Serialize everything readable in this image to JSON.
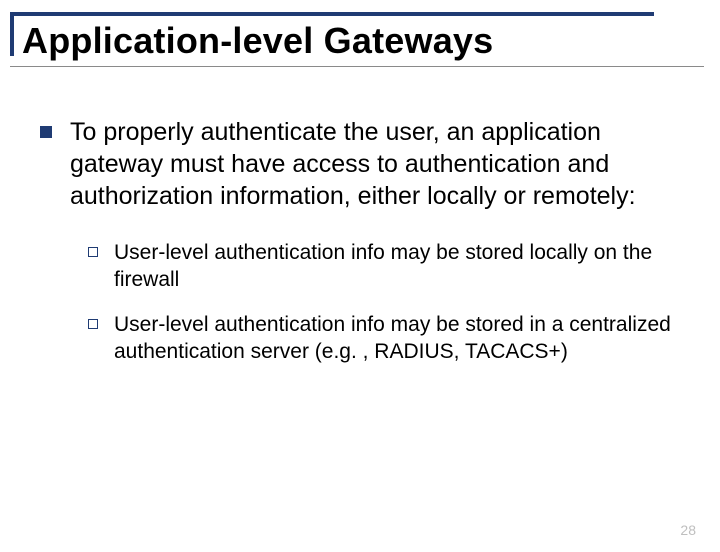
{
  "slide": {
    "title": "Application-level Gateways",
    "page_number": "28"
  },
  "content": {
    "lvl1": "To properly authenticate the user, an application gateway must have access to authentication and authorization information, either locally or remotely:",
    "lvl2": [
      "User-level authentication info may be stored locally on the firewall",
      "User-level authentication info may be stored in a centralized authentication server (e.g. , RADIUS, TACACS+)"
    ]
  }
}
